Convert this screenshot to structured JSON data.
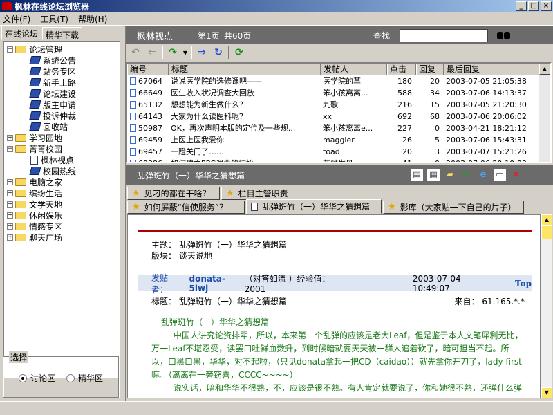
{
  "window": {
    "title": "枫林在线论坛浏览器",
    "buttons": [
      "_",
      "□",
      "×"
    ]
  },
  "menu": [
    "文件(F)",
    "工具(T)",
    "帮助(H)"
  ],
  "left": {
    "tabs": [
      "在线论坛",
      "精华下载"
    ],
    "tree": [
      {
        "label": "论坛管理",
        "type": "folder-open",
        "level": 0,
        "expander": "−"
      },
      {
        "label": "系统公告",
        "type": "book",
        "level": 1
      },
      {
        "label": "站务专区",
        "type": "book",
        "level": 1
      },
      {
        "label": "新手上路",
        "type": "book",
        "level": 1
      },
      {
        "label": "论坛建设",
        "type": "book",
        "level": 1
      },
      {
        "label": "版主申请",
        "type": "book",
        "level": 1
      },
      {
        "label": "投诉仲裁",
        "type": "book",
        "level": 1
      },
      {
        "label": "回收站",
        "type": "book",
        "level": 1
      },
      {
        "label": "学习园地",
        "type": "folder",
        "level": 0,
        "expander": "+"
      },
      {
        "label": "菁菁校园",
        "type": "folder-open",
        "level": 0,
        "expander": "−"
      },
      {
        "label": "枫林视点",
        "type": "page",
        "level": 1
      },
      {
        "label": "校园热线",
        "type": "book",
        "level": 1
      },
      {
        "label": "电脑之家",
        "type": "folder",
        "level": 0,
        "expander": "+"
      },
      {
        "label": "缤纷生活",
        "type": "folder",
        "level": 0,
        "expander": "+"
      },
      {
        "label": "文学天地",
        "type": "folder",
        "level": 0,
        "expander": "+"
      },
      {
        "label": "休闲娱乐",
        "type": "folder",
        "level": 0,
        "expander": "+"
      },
      {
        "label": "情感专区",
        "type": "folder",
        "level": 0,
        "expander": "+"
      },
      {
        "label": "聊天广场",
        "type": "folder",
        "level": 0,
        "expander": "+"
      }
    ],
    "select_group": {
      "legend": "选择",
      "options": [
        "讨论区",
        "精华区"
      ],
      "selected": 0
    }
  },
  "header": {
    "section": "枫林视点",
    "page": "第1页",
    "total": "共60页",
    "find_label": "查找",
    "search_value": ""
  },
  "list": {
    "columns": [
      "编号",
      "标题",
      "发帖人",
      "点击",
      "回复",
      "最后回复"
    ],
    "rows": [
      [
        "67064",
        "说说医学院的选修课吧——",
        "医学院的草",
        "180",
        "20",
        "2003-07-05 21:05:38"
      ],
      [
        "66649",
        "医生收入状况调查大回放",
        "笨小孩离离...",
        "588",
        "34",
        "2003-07-06 14:13:37"
      ],
      [
        "65132",
        "想想能为新生做什么？",
        "九歌",
        "216",
        "15",
        "2003-07-05 21:20:30"
      ],
      [
        "64143",
        "大家为什么读医科呢？",
        "xx",
        "692",
        "68",
        "2003-07-06 20:06:02"
      ],
      [
        "50987",
        "OK，再次声明本版的定位及一些规...",
        "笨小孩离离e...",
        "227",
        "0",
        "2003-04-21 18:21:12"
      ],
      [
        "69459",
        "上医上医我爱你",
        "maggier",
        "26",
        "5",
        "2003-07-06 15:43:31"
      ],
      [
        "69457",
        "一蹬关门了……",
        "toad",
        "20",
        "3",
        "2003-07-07 15:21:26"
      ],
      [
        "69386",
        "如何建立PPC课业的初始",
        "花雅发见",
        "41",
        "0",
        "2003-07-06 20:10:03"
      ]
    ]
  },
  "post": {
    "bar_title": "乱弹斑竹（一）华华之猜想篇",
    "tabs_row1": [
      "见刁的都在干啥？",
      "栏目主管职责"
    ],
    "tabs_row2": [
      "如何屏蔽“信使服务”？",
      "乱弹斑竹（一）华华之猜想篇",
      "影库（大家贴一下自己的片子）"
    ],
    "subject_label": "主题：",
    "subject": "乱弹斑竹（一）华华之猜想篇",
    "board_label": "版块：",
    "board": "谈天说地",
    "poster_label": "发贴者：",
    "poster": "donata-5iwj",
    "poster_extra": "（对答如流 ）经验值：2001",
    "date": "2003-07-04 10:49:07",
    "top": "Top",
    "title_label": "标题：",
    "title": "乱弹斑竹（一）华华之猜想篇",
    "from_label": "来自：",
    "from": "61.165.*.*",
    "body_heading": "乱弹斑竹（一）华华之猜想篇",
    "body_p1": "中国人讲究论资排辈，所以，本来第一个乱弹的应该是老大Leaf，但是鉴于本人文笔犀利无比，万一Leaf不堪忍受，读罢口吐鲜血数升，到时候暗就要天天被一群人追着砍了，暗可担当不起。所以，口黑口黑，华华，对不起啦，（只见donata拿起一把CD（caidao））就先拿你开刀了，lady first嘛。（离离在一旁窃喜，CCCC~~~~）",
    "body_p2": "说实话，暗和华华不很熟，不，应该是很不熟。有人肯定就要说了，你和她很不熟，还弹什么弹"
  }
}
